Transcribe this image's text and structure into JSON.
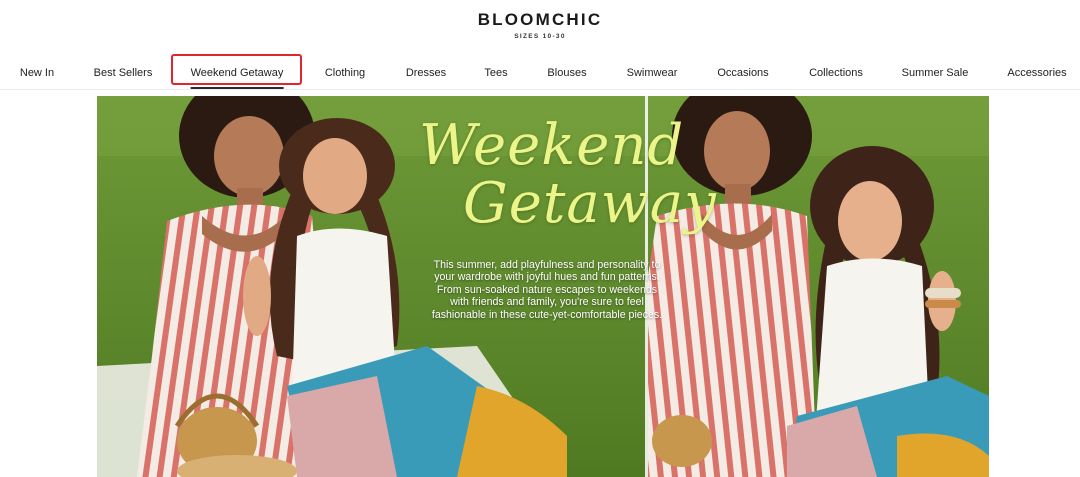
{
  "header": {
    "brand": "BLOOMCHIC",
    "tagline": "SIZES 10-30"
  },
  "nav": {
    "items": [
      {
        "label": "New In"
      },
      {
        "label": "Best Sellers"
      },
      {
        "label": "Weekend Getaway",
        "active": true
      },
      {
        "label": "Clothing"
      },
      {
        "label": "Dresses"
      },
      {
        "label": "Tees"
      },
      {
        "label": "Blouses"
      },
      {
        "label": "Swimwear"
      },
      {
        "label": "Occasions"
      },
      {
        "label": "Collections"
      },
      {
        "label": "Summer Sale"
      },
      {
        "label": "Accessories"
      }
    ],
    "highlight_color": "#e3242b"
  },
  "banner": {
    "title_line1": "Weekend",
    "title_line2": "Getaway",
    "copy": "This summer, add playfulness and personality to your wardrobe with joyful hues and fun patterns. From sun-soaked nature escapes to weekends with friends and family, you're sure to feel fashionable in these cute-yet-comfortable pieces.",
    "colors": {
      "grass": "#5f8a2e",
      "title": "#ecf58a"
    }
  }
}
